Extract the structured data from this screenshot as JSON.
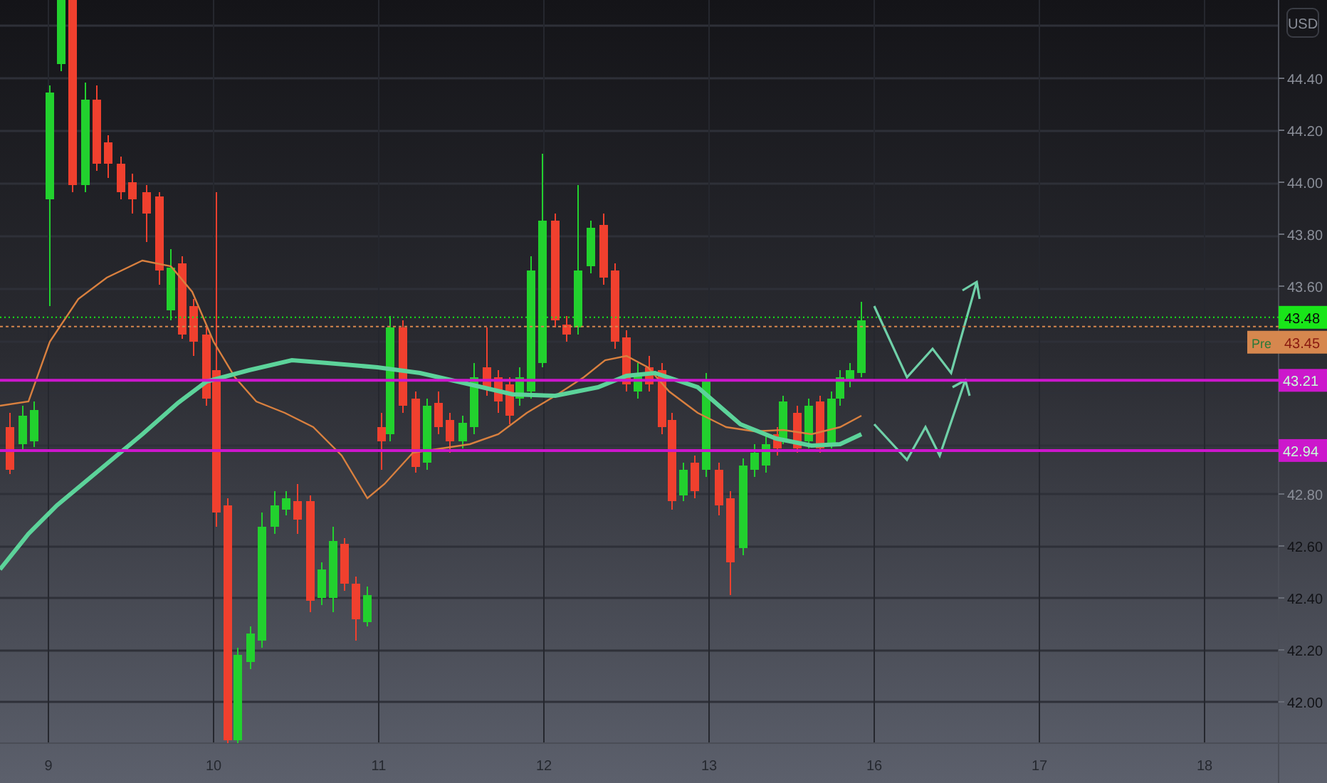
{
  "currency": "USD",
  "price_axis": {
    "ticks": [
      "44.40",
      "44.20",
      "44.00",
      "43.80",
      "43.60",
      "42.80",
      "42.60",
      "42.40",
      "42.20",
      "42.00"
    ]
  },
  "price_labels": [
    {
      "kind": "last",
      "text": "43.48",
      "color": "#19e619"
    },
    {
      "kind": "pre",
      "prefix": "Pre",
      "text": "43.45",
      "color": "#d6874e"
    },
    {
      "kind": "level",
      "text": "43.21",
      "color": "#cc17cc"
    },
    {
      "kind": "level",
      "text": "42.94",
      "color": "#cc17cc"
    }
  ],
  "time_axis": {
    "ticks": [
      "9",
      "10",
      "11",
      "12",
      "13",
      "16",
      "17",
      "18"
    ]
  }
}
